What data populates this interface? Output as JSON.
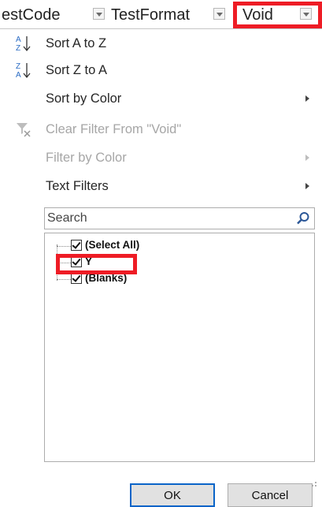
{
  "header": {
    "col1": "estCode",
    "col2": "TestFormat",
    "col3": "Void"
  },
  "menu": {
    "sort_az": "Sort A to Z",
    "sort_za": "Sort Z to A",
    "sort_color": "Sort by Color",
    "clear_filter": "Clear Filter From \"Void\"",
    "filter_color": "Filter by Color",
    "text_filters": "Text Filters"
  },
  "search": {
    "placeholder": "Search"
  },
  "filter_list": [
    {
      "label": "(Select All)",
      "checked": true
    },
    {
      "label": "Y",
      "checked": true
    },
    {
      "label": "(Blanks)",
      "checked": true
    }
  ],
  "buttons": {
    "ok": "OK",
    "cancel": "Cancel"
  },
  "colors": {
    "highlight": "#ee1c25",
    "accent": "#0a64c8"
  }
}
